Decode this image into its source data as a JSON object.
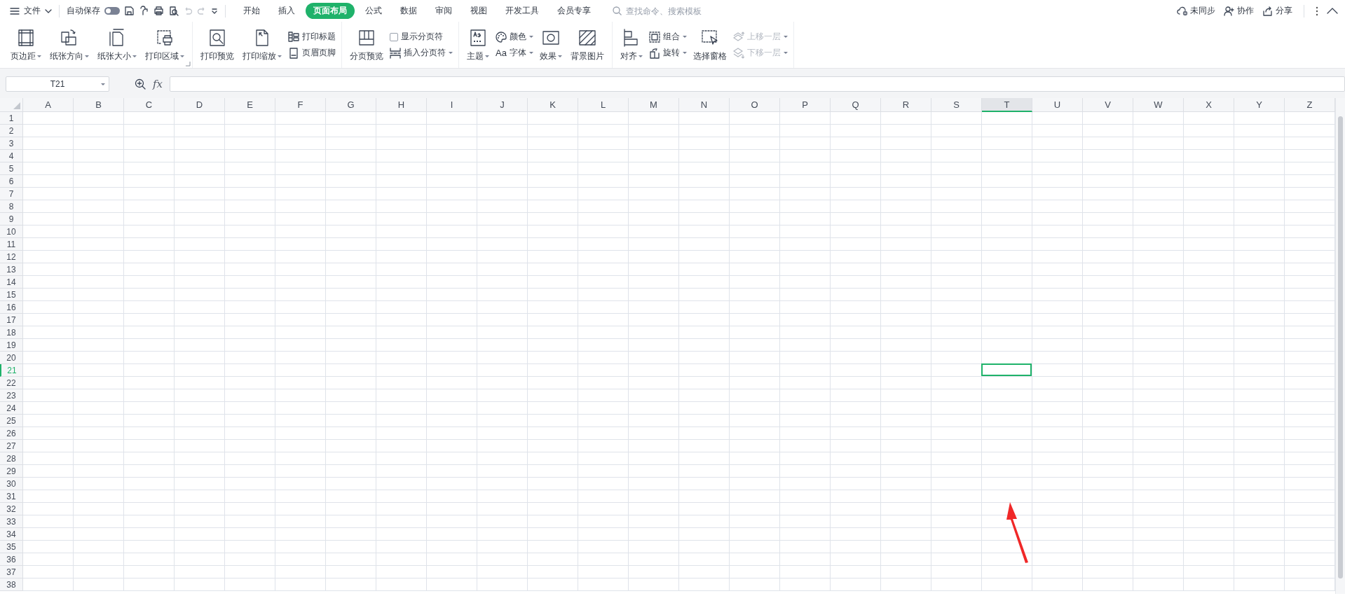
{
  "title_bar": {
    "file_menu": {
      "label": "文件"
    },
    "autosave": {
      "label": "自动保存",
      "on": false
    },
    "tabs": [
      {
        "label": "开始",
        "selected": false
      },
      {
        "label": "插入",
        "selected": false
      },
      {
        "label": "页面布局",
        "selected": true
      },
      {
        "label": "公式",
        "selected": false
      },
      {
        "label": "数据",
        "selected": false
      },
      {
        "label": "审阅",
        "selected": false
      },
      {
        "label": "视图",
        "selected": false
      },
      {
        "label": "开发工具",
        "selected": false
      },
      {
        "label": "会员专享",
        "selected": false
      }
    ],
    "search": {
      "placeholder": "查找命令、搜索模板"
    },
    "actions": [
      {
        "label": "未同步"
      },
      {
        "label": "协作"
      },
      {
        "label": "分享"
      }
    ]
  },
  "ribbon": {
    "groups": [
      {
        "launcher": true,
        "items": [
          {
            "kind": "large",
            "label": "页边距",
            "dropdown": true
          },
          {
            "kind": "large",
            "label": "纸张方向",
            "dropdown": true
          },
          {
            "kind": "large",
            "label": "纸张大小",
            "dropdown": true
          },
          {
            "kind": "large",
            "label": "打印区域",
            "dropdown": true
          }
        ]
      },
      {
        "launcher": false,
        "items": [
          {
            "kind": "large",
            "label": "打印预览",
            "dropdown": false
          },
          {
            "kind": "large",
            "label": "打印缩放",
            "dropdown": true
          },
          {
            "kind": "stack",
            "items": [
              {
                "kind": "small",
                "label": "打印标题",
                "dropdown": false,
                "disabled": false
              },
              {
                "kind": "small",
                "label": "页眉页脚",
                "dropdown": false,
                "disabled": false
              }
            ]
          }
        ]
      },
      {
        "launcher": false,
        "items": [
          {
            "kind": "large",
            "label": "分页预览",
            "dropdown": false
          },
          {
            "kind": "stack",
            "items": [
              {
                "kind": "checkbox",
                "label": "显示分页符",
                "checked": false
              },
              {
                "kind": "small",
                "label": "插入分页符",
                "dropdown": true,
                "disabled": false
              }
            ]
          }
        ]
      },
      {
        "launcher": false,
        "items": [
          {
            "kind": "large",
            "label": "主题",
            "dropdown": true
          },
          {
            "kind": "stack",
            "items": [
              {
                "kind": "small",
                "label": "颜色",
                "dropdown": true,
                "disabled": false
              },
              {
                "kind": "small",
                "label": "字体",
                "icon_text": "Aa",
                "dropdown": true,
                "disabled": false
              }
            ]
          },
          {
            "kind": "large",
            "label": "效果",
            "dropdown": true
          },
          {
            "kind": "large",
            "label": "背景图片",
            "dropdown": false
          }
        ]
      },
      {
        "launcher": false,
        "items": [
          {
            "kind": "large",
            "label": "对齐",
            "dropdown": true
          },
          {
            "kind": "stack",
            "items": [
              {
                "kind": "small",
                "label": "组合",
                "dropdown": true,
                "disabled": false
              },
              {
                "kind": "small",
                "label": "旋转",
                "dropdown": true,
                "disabled": false
              }
            ]
          },
          {
            "kind": "large",
            "label": "选择窗格",
            "dropdown": false
          },
          {
            "kind": "stack",
            "items": [
              {
                "kind": "small",
                "label": "上移一层",
                "dropdown": true,
                "disabled": true
              },
              {
                "kind": "small",
                "label": "下移一层",
                "dropdown": true,
                "disabled": true
              }
            ]
          }
        ]
      }
    ]
  },
  "formula_bar": {
    "name_box": "T21",
    "fx": "fx"
  },
  "sheet": {
    "columns": [
      {
        "label": "A",
        "selected": false
      },
      {
        "label": "B",
        "selected": false
      },
      {
        "label": "C",
        "selected": false
      },
      {
        "label": "D",
        "selected": false
      },
      {
        "label": "E",
        "selected": false
      },
      {
        "label": "F",
        "selected": false
      },
      {
        "label": "G",
        "selected": false
      },
      {
        "label": "H",
        "selected": false
      },
      {
        "label": "I",
        "selected": false
      },
      {
        "label": "J",
        "selected": false
      },
      {
        "label": "K",
        "selected": false
      },
      {
        "label": "L",
        "selected": false
      },
      {
        "label": "M",
        "selected": false
      },
      {
        "label": "N",
        "selected": false
      },
      {
        "label": "O",
        "selected": false
      },
      {
        "label": "P",
        "selected": false
      },
      {
        "label": "Q",
        "selected": false
      },
      {
        "label": "R",
        "selected": false
      },
      {
        "label": "S",
        "selected": false
      },
      {
        "label": "T",
        "selected": true
      },
      {
        "label": "U",
        "selected": false
      },
      {
        "label": "V",
        "selected": false
      },
      {
        "label": "W",
        "selected": false
      },
      {
        "label": "X",
        "selected": false
      },
      {
        "label": "Y",
        "selected": false
      },
      {
        "label": "Z",
        "selected": false
      }
    ],
    "rows": [
      {
        "label": "1",
        "selected": false
      },
      {
        "label": "2",
        "selected": false
      },
      {
        "label": "3",
        "selected": false
      },
      {
        "label": "4",
        "selected": false
      },
      {
        "label": "5",
        "selected": false
      },
      {
        "label": "6",
        "selected": false
      },
      {
        "label": "7",
        "selected": false
      },
      {
        "label": "8",
        "selected": false
      },
      {
        "label": "9",
        "selected": false
      },
      {
        "label": "10",
        "selected": false
      },
      {
        "label": "11",
        "selected": false
      },
      {
        "label": "12",
        "selected": false
      },
      {
        "label": "13",
        "selected": false
      },
      {
        "label": "14",
        "selected": false
      },
      {
        "label": "15",
        "selected": false
      },
      {
        "label": "16",
        "selected": false
      },
      {
        "label": "17",
        "selected": false
      },
      {
        "label": "18",
        "selected": false
      },
      {
        "label": "19",
        "selected": false
      },
      {
        "label": "20",
        "selected": false
      },
      {
        "label": "21",
        "selected": true
      },
      {
        "label": "22",
        "selected": false
      },
      {
        "label": "23",
        "selected": false
      },
      {
        "label": "24",
        "selected": false
      },
      {
        "label": "25",
        "selected": false
      },
      {
        "label": "26",
        "selected": false
      },
      {
        "label": "27",
        "selected": false
      },
      {
        "label": "28",
        "selected": false
      },
      {
        "label": "29",
        "selected": false
      },
      {
        "label": "30",
        "selected": false
      },
      {
        "label": "31",
        "selected": false
      },
      {
        "label": "32",
        "selected": false
      },
      {
        "label": "33",
        "selected": false
      },
      {
        "label": "34",
        "selected": false
      },
      {
        "label": "35",
        "selected": false
      },
      {
        "label": "36",
        "selected": false
      },
      {
        "label": "37",
        "selected": false
      },
      {
        "label": "38",
        "selected": false
      }
    ]
  }
}
